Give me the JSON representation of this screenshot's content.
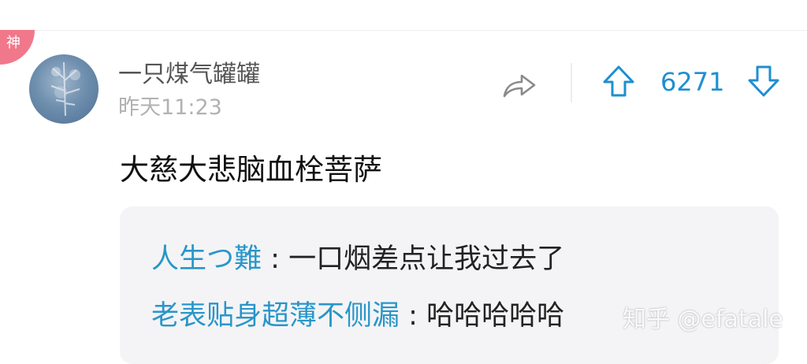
{
  "badge": {
    "label": "神"
  },
  "comment": {
    "username": "一只煤气罐罐",
    "time": "昨天11:23",
    "vote_count": "6271",
    "text": "大慈大悲脑血栓菩萨"
  },
  "replies": [
    {
      "author": "人生つ難",
      "separator": ":",
      "message": "一口烟差点让我过去了"
    },
    {
      "author": "老表贴身超薄不侧漏",
      "separator": ":",
      "message": "哈哈哈哈哈"
    }
  ],
  "watermark": "知乎 @efatale",
  "colors": {
    "accent": "#1f8fd0",
    "badge": "#f0788a",
    "reply_author": "#2996c9"
  },
  "icons": {
    "share": "share-arrow-icon",
    "upvote": "arrow-up-icon",
    "downvote": "arrow-down-icon"
  }
}
